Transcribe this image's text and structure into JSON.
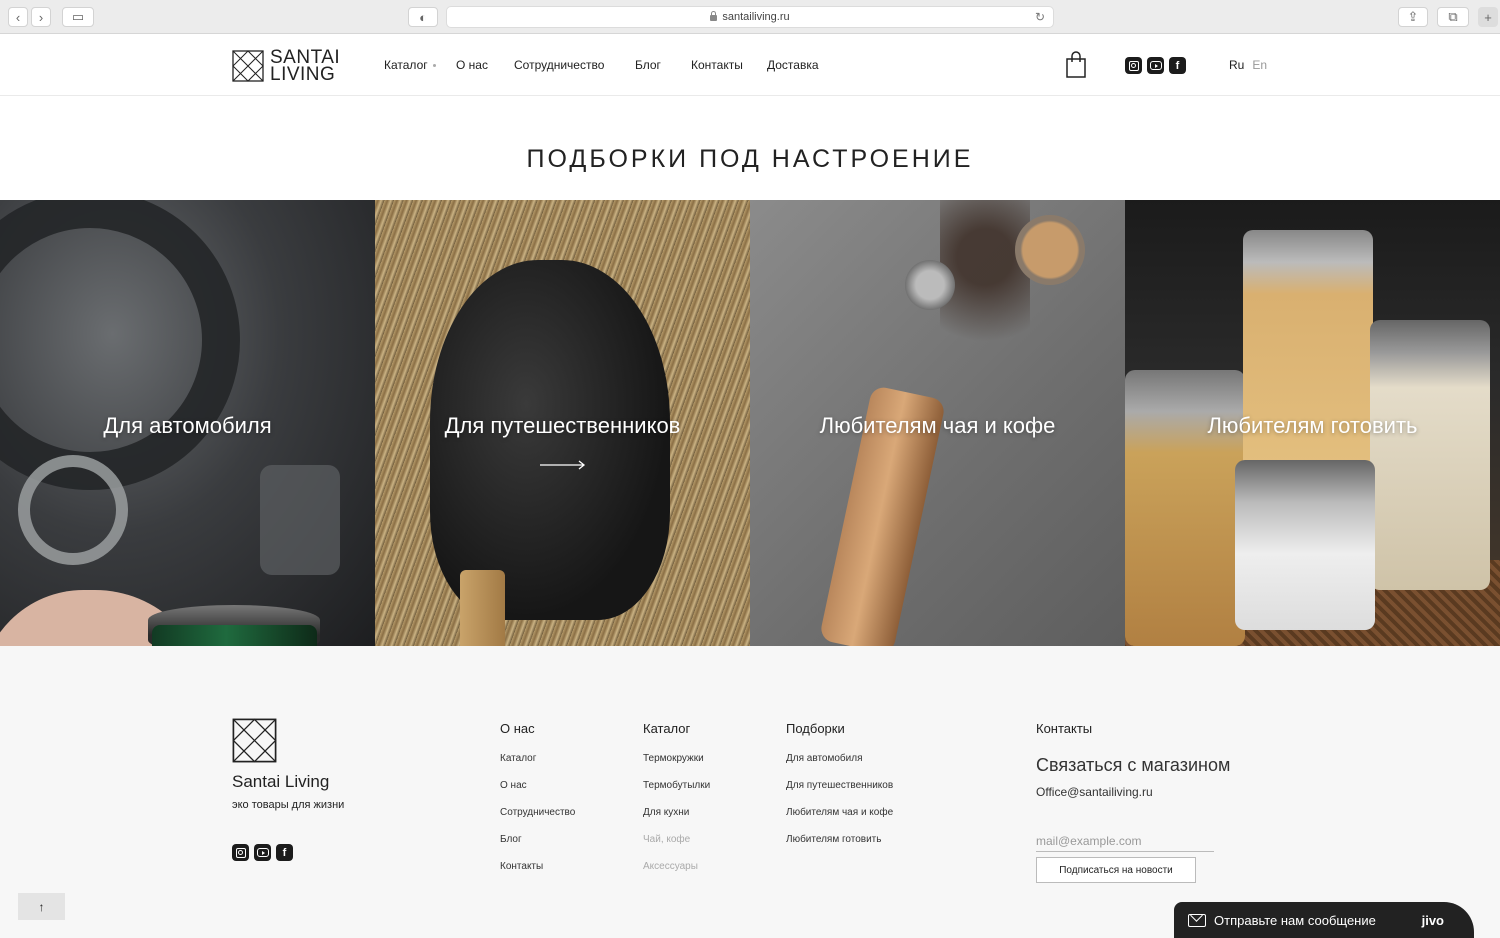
{
  "browser": {
    "url": "santailiving.ru"
  },
  "header": {
    "logo_line1": "SANTAI",
    "logo_line2": "LIVING",
    "nav": [
      "Каталог",
      "О нас",
      "Сотрудничество",
      "Блог",
      "Контакты",
      "Доставка"
    ],
    "lang_ru": "Ru",
    "lang_en": "En"
  },
  "main": {
    "title": "ПОДБОРКИ ПОД НАСТРОЕНИЕ",
    "tiles": [
      {
        "label": "Для автомобиля"
      },
      {
        "label": "Для путешественников"
      },
      {
        "label": "Любителям чая и кофе"
      },
      {
        "label": "Любителям готовить"
      }
    ]
  },
  "footer": {
    "brand": "Santai Living",
    "tagline": "эко товары для жизни",
    "about": {
      "heading": "О нас",
      "links": [
        "Каталог",
        "О нас",
        "Сотрудничество",
        "Блог",
        "Контакты"
      ]
    },
    "catalog": {
      "heading": "Каталог",
      "links": [
        "Термокружки",
        "Термобутылки",
        "Для кухни",
        "Чай, кофе",
        "Аксессуары"
      ]
    },
    "collections": {
      "heading": "Подборки",
      "links": [
        "Для автомобиля",
        "Для путешественников",
        "Любителям чая и кофе",
        "Любителям готовить"
      ]
    },
    "contacts": {
      "heading": "Контакты",
      "title": "Связаться с магазином",
      "email": "Office@santailiving.ru",
      "input_placeholder": "mail@example.com",
      "subscribe_label": "Подписаться на новости"
    }
  },
  "widgets": {
    "to_top": "↑",
    "chat_label": "Отправьте нам сообщение",
    "chat_brand": "jivo"
  },
  "colors": {
    "text": "#222222",
    "footer_bg": "#f7f7f7",
    "chat_bg": "#222222"
  }
}
